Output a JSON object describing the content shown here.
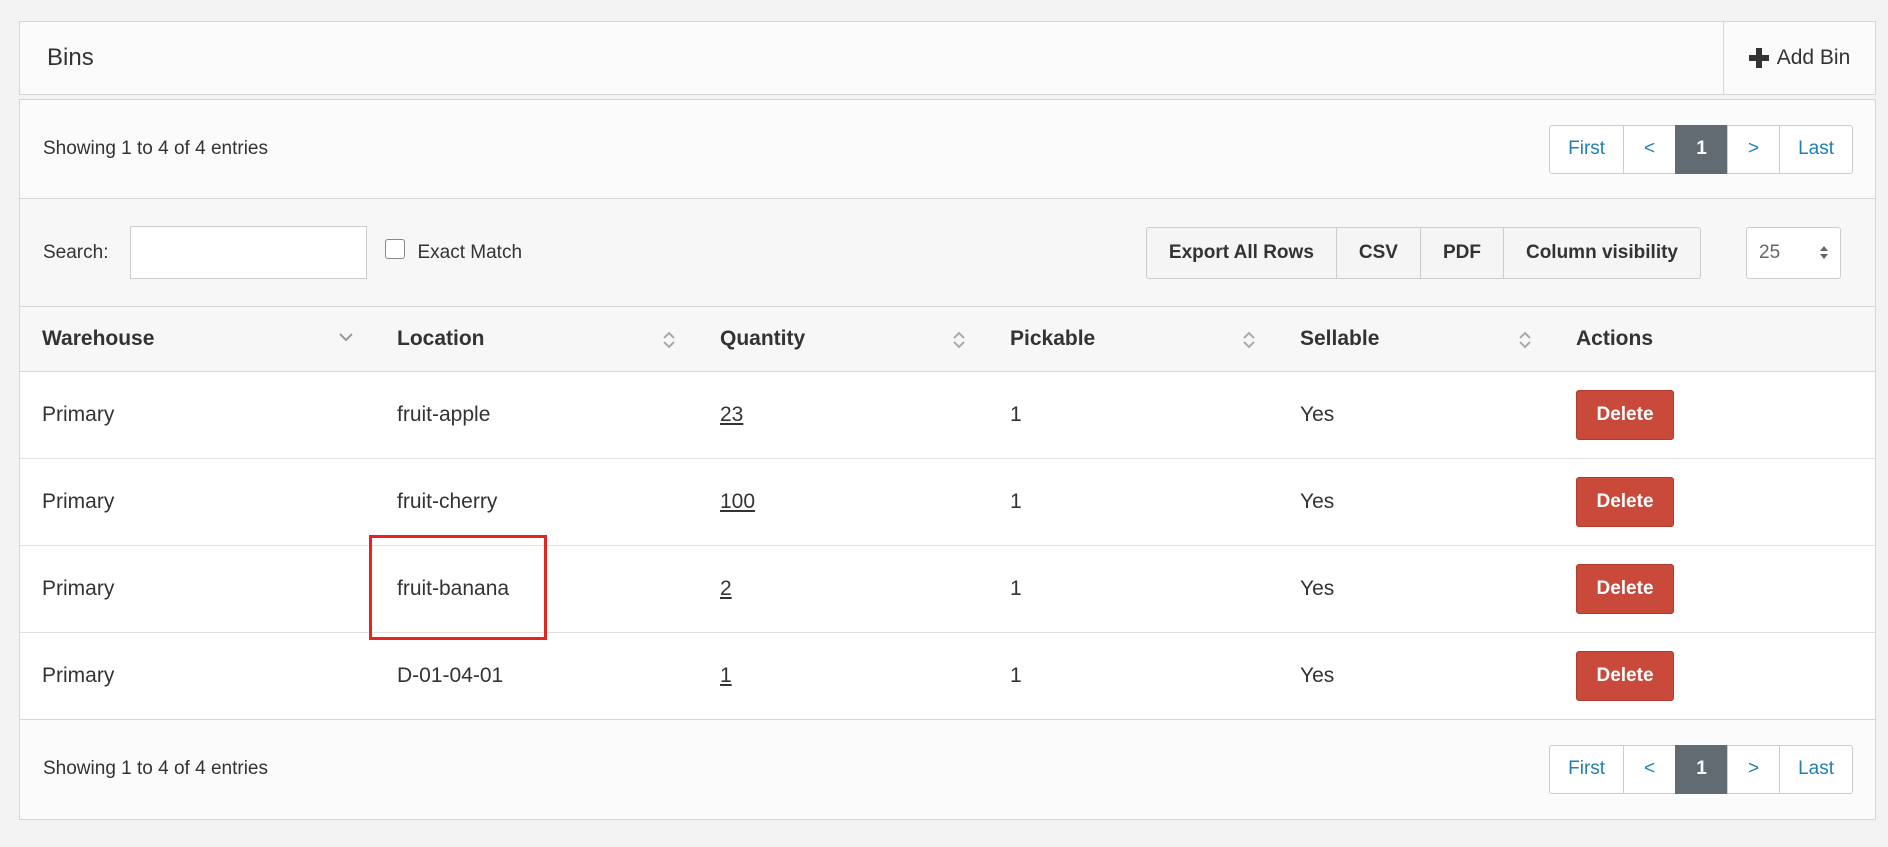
{
  "header": {
    "title": "Bins",
    "add_label": "Add Bin"
  },
  "info": {
    "top": "Showing 1 to 4 of 4 entries",
    "bottom": "Showing 1 to 4 of 4 entries"
  },
  "pager": {
    "first": "First",
    "prev": "<",
    "current": "1",
    "next": ">",
    "last": "Last"
  },
  "search": {
    "label": "Search:",
    "value": "",
    "exact_label": "Exact Match"
  },
  "buttons": {
    "export": "Export All Rows",
    "csv": "CSV",
    "pdf": "PDF",
    "colvis": "Column visibility"
  },
  "page_size": "25",
  "columns": [
    "Warehouse",
    "Location",
    "Quantity",
    "Pickable",
    "Sellable",
    "Actions"
  ],
  "rows": [
    {
      "warehouse": "Primary",
      "location": "fruit-apple",
      "quantity": "23",
      "pickable": "1",
      "sellable": "Yes",
      "action": "Delete"
    },
    {
      "warehouse": "Primary",
      "location": "fruit-cherry",
      "quantity": "100",
      "pickable": "1",
      "sellable": "Yes",
      "action": "Delete"
    },
    {
      "warehouse": "Primary",
      "location": "fruit-banana",
      "quantity": "2",
      "pickable": "1",
      "sellable": "Yes",
      "action": "Delete"
    },
    {
      "warehouse": "Primary",
      "location": "D-01-04-01",
      "quantity": "1",
      "pickable": "1",
      "sellable": "Yes",
      "action": "Delete"
    }
  ],
  "colors": {
    "accent_link": "#1f7fb6",
    "active_page": "#636b72",
    "delete": "#c9493b",
    "highlight": "#e3261f"
  }
}
